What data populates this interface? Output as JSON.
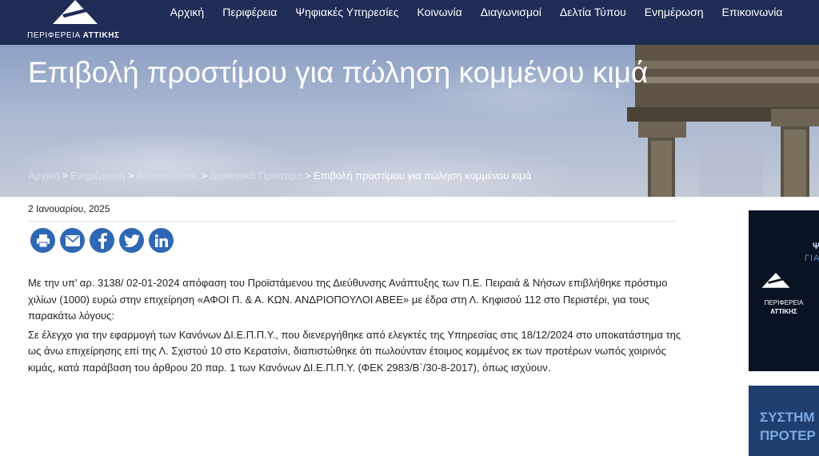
{
  "header": {
    "logo_text_light": "ΠΕΡΙΦΕΡΕΙΑ",
    "logo_text_bold": "ΑΤΤΙΚΗΣ",
    "nav": [
      "Αρχική",
      "Περιφέρεια",
      "Ψηφιακές Υπηρεσίες",
      "Κοινωνία",
      "Διαγωνισμοί",
      "Δελτία Τύπου",
      "Ενημέρωση",
      "Επικοινωνία"
    ]
  },
  "hero": {
    "title": "Επιβολή προστίμου για πώληση κομμένου κιμά"
  },
  "breadcrumb": {
    "items": [
      "Αρχική",
      "Ενημέρωση",
      "Ανακοινώσεις",
      "Διοικητικά Πρόστιμα"
    ],
    "separator": ">",
    "current": "Επιβολή προστίμου για πώληση κομμένου κιμά"
  },
  "article": {
    "date": "2 Ιανουαρίου, 2025",
    "share": [
      "print-icon",
      "email-icon",
      "facebook-icon",
      "twitter-icon",
      "linkedin-icon"
    ],
    "paragraphs": [
      "Με την υπ’ αρ. 3138/ 02-01-2024 απόφαση του Προϊστάμενου της Διεύθυνσης Ανάπτυξης των Π.Ε. Πειραιά & Νήσων επιβλήθηκε πρόστιμο χιλίων (1000) ευρώ στην επιχείρηση «ΑΦΟΙ Π. & Α. ΚΩΝ. ΑΝΔΡΙΟΠΟΥΛΟΙ ΑΒΕΕ» με έδρα στη Λ. Κηφισού 112 στο Περιστέρι, για τους παρακάτω λόγους:",
      "Σε έλεγχο για την εφαρμογή των Κανόνων ΔΙ.Ε.Π.Π.Υ., που διενεργήθηκε από ελεγκτές της Υπηρεσίας στις 18/12/2024 στο υποκατάστημα της ως άνω επιχείρησης επί της Λ. Σχιστού 10 στο Κερατσίνι, διαπιστώθηκε ότι πωλούνταν έτοιμος κομμένος εκ των προτέρων νωπός χοιρινός κιμάς, κατά παράβαση του άρθρου 20 παρ. 1 των Κανόνων ΔΙ.Ε.Π.Π.Υ. (ΦΕΚ 2983/Β΄/30-8-2017), όπως ισχύουν."
    ]
  },
  "sidebar": {
    "banner1": {
      "line1": "Ψ",
      "line2": "ΓΙΑ",
      "logo_light": "ΠΕΡΙΦΕΡΕΙΑ",
      "logo_bold": "ΑΤΤΙΚΗΣ"
    },
    "banner2": {
      "line1": "ΣΥΣΤΗΜ",
      "line2": "ΠΡΟΤΕΡ"
    }
  },
  "colors": {
    "header_bg": "#1f2c55",
    "share_icon": "#2f67b4"
  }
}
